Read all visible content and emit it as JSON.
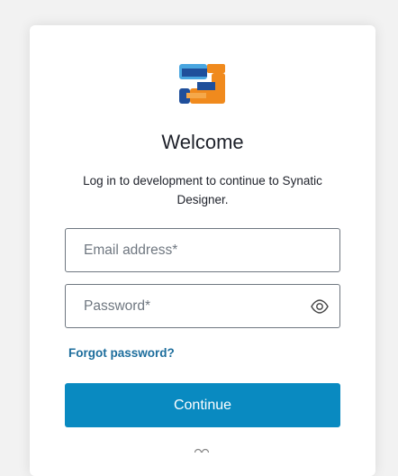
{
  "login": {
    "title": "Welcome",
    "subtitle": "Log in to development to continue to Synatic Designer.",
    "email_placeholder": "Email address*",
    "password_placeholder": "Password*",
    "forgot_password": "Forgot password?",
    "continue_label": "Continue"
  },
  "icons": {
    "logo": "synatic-logo-icon",
    "password_toggle": "eye-icon"
  },
  "colors": {
    "primary_button": "#098ac1",
    "link": "#1c6d9c",
    "field_border": "#6f7780",
    "text": "#1e212a",
    "logo_blue": "#1f4f9b",
    "logo_orange": "#f08a1d",
    "logo_light_blue": "#49a6e0"
  }
}
